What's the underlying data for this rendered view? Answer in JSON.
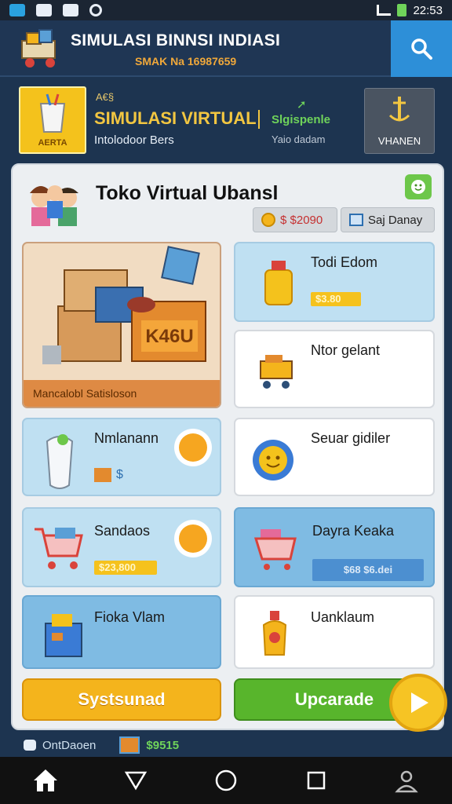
{
  "status": {
    "time": "22:53"
  },
  "header": {
    "title": "SIMULASI BINNSI INDIASI",
    "subtitle": "SMAK Na 16987659",
    "search_icon": "search-icon"
  },
  "banner": {
    "left_label": "AERTA",
    "small_label": "A€§",
    "title": "SIMULASI VIRTUAL",
    "green_text": "Slgispenle",
    "info": "Intolodoor Bers",
    "info2": "Yaio dadam",
    "right_label": "VHANEN"
  },
  "store": {
    "title": "Toko Virtual Ubansl",
    "coins": "$ $2090",
    "day": "Saj Danay"
  },
  "cards": {
    "featured": {
      "label": "Mancalobl Satisloson",
      "crate_label": "K46U"
    },
    "c1": {
      "title": "Todi Edom",
      "price": "$3.80"
    },
    "c2": {
      "title": "Ntor gelant"
    },
    "c3": {
      "title": "Nmlanann",
      "price": "$"
    },
    "c4": {
      "title": "Seuar gidiler"
    },
    "c5": {
      "title": "Sandaos",
      "price": "$23,800"
    },
    "c6": {
      "title": "Dayra Keaka",
      "price": "$68 $6.dei"
    },
    "c7": {
      "title": "Fioka Vlam"
    },
    "c8": {
      "title": "Uanklaum"
    }
  },
  "buttons": {
    "left": "Systsunad",
    "right": "Upcarade"
  },
  "infostrip": {
    "label": "OntDaoen",
    "value": "$9515"
  },
  "colors": {
    "accent_blue": "#2d8fd8",
    "accent_yellow": "#f4b41c",
    "accent_green": "#58b52c",
    "header_bg": "#1f3654"
  }
}
